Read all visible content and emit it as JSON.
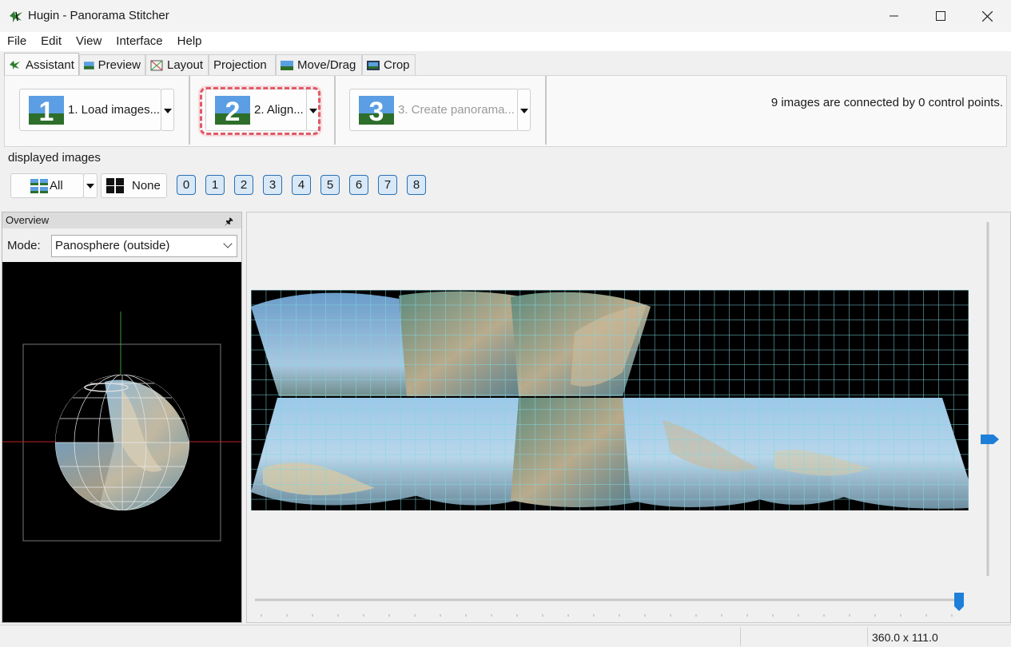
{
  "window": {
    "title": "Hugin - Panorama Stitcher",
    "controls": [
      "minimize-icon",
      "maximize-icon",
      "close-icon"
    ]
  },
  "menu": [
    "File",
    "Edit",
    "View",
    "Interface",
    "Help"
  ],
  "tabs": [
    {
      "label": "Assistant",
      "icon": "assistant-icon",
      "active": true
    },
    {
      "label": "Preview",
      "icon": "preview-icon",
      "active": false
    },
    {
      "label": "Layout",
      "icon": "layout-icon",
      "active": false
    },
    {
      "label": "Projection",
      "icon": "",
      "active": false
    },
    {
      "label": "Move/Drag",
      "icon": "move-drag-icon",
      "active": false
    },
    {
      "label": "Crop",
      "icon": "crop-icon",
      "active": false
    }
  ],
  "assistant": {
    "step1": {
      "number": "1",
      "label": "1. Load images..."
    },
    "step2": {
      "number": "2",
      "label": "2. Align..."
    },
    "step3": {
      "number": "3",
      "label": "3. Create panorama..."
    },
    "status": "9 images are connected by 0 control points."
  },
  "displayed_images": {
    "label": "displayed images",
    "all_label": "All",
    "none_label": "None",
    "numbers": [
      "0",
      "1",
      "2",
      "3",
      "4",
      "5",
      "6",
      "7",
      "8"
    ]
  },
  "overview": {
    "title": "Overview",
    "mode_label": "Mode:",
    "mode_value": "Panosphere (outside)"
  },
  "status_bar": {
    "fov": "360.0 x 111.0"
  },
  "colors": {
    "accent": "#1e7fd8",
    "highlight": "#e05a66",
    "grid": "#7fd6e0"
  }
}
